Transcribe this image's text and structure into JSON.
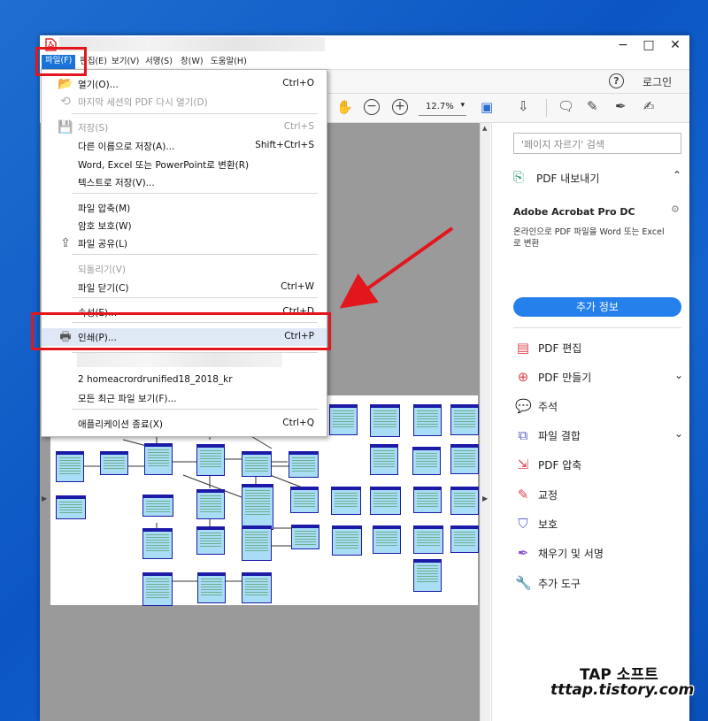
{
  "menubar": {
    "items": [
      "파일(F)",
      "편집(E)",
      "보기(V)",
      "서명(S)",
      "창(W)",
      "도움말(H)"
    ]
  },
  "window_controls": {
    "minimize": "−",
    "maximize": "□",
    "close": "✕"
  },
  "toolbar": {
    "help": "?",
    "login": "로그인",
    "zoom": "12.7%"
  },
  "file_menu": {
    "items": [
      {
        "label": "열기(O)...",
        "shortcut": "Ctrl+O",
        "disabled": false,
        "icon": "folder-open-icon"
      },
      {
        "label": "마지막 세션의 PDF 다시 열기(D)",
        "shortcut": "",
        "disabled": true,
        "icon": "reopen-icon"
      },
      {
        "label": "저장(S)",
        "shortcut": "Ctrl+S",
        "disabled": true,
        "icon": "save-icon"
      },
      {
        "label": "다른 이름으로 저장(A)...",
        "shortcut": "Shift+Ctrl+S",
        "disabled": false,
        "icon": ""
      },
      {
        "label": "Word, Excel 또는 PowerPoint로 변환(R)",
        "shortcut": "",
        "disabled": false,
        "icon": ""
      },
      {
        "label": "텍스트로 저장(V)...",
        "shortcut": "",
        "disabled": false,
        "icon": ""
      },
      {
        "label": "파일 압축(M)",
        "shortcut": "",
        "disabled": false,
        "icon": ""
      },
      {
        "label": "암호 보호(W)",
        "shortcut": "",
        "disabled": false,
        "icon": ""
      },
      {
        "label": "파일 공유(L)",
        "shortcut": "",
        "disabled": false,
        "icon": "share-icon"
      },
      {
        "label": "되돌리기(V)",
        "shortcut": "",
        "disabled": true,
        "icon": ""
      },
      {
        "label": "파일 닫기(C)",
        "shortcut": "Ctrl+W",
        "disabled": false,
        "icon": ""
      },
      {
        "label": "속성(E)...",
        "shortcut": "Ctrl+D",
        "disabled": false,
        "icon": ""
      },
      {
        "label": "인쇄(P)...",
        "shortcut": "Ctrl+P",
        "disabled": false,
        "icon": "printer-icon"
      },
      {
        "label": "2 homeacrordrunified18_2018_kr",
        "shortcut": "",
        "disabled": false,
        "icon": ""
      },
      {
        "label": "모든 최근 파일 보기(F)...",
        "shortcut": "",
        "disabled": false,
        "icon": ""
      },
      {
        "label": "애플리케이션 종료(X)",
        "shortcut": "Ctrl+Q",
        "disabled": false,
        "icon": ""
      }
    ]
  },
  "right_panel": {
    "search_placeholder": "'페이지 자르기' 검색",
    "export_title": "PDF 내보내기",
    "product_name": "Adobe Acrobat Pro DC",
    "product_desc_1": "온라인으로 PDF 파일을 Word 또는 Excel",
    "product_desc_2": "로 변환",
    "more_info_button": "추가 정보",
    "tools": [
      {
        "label": "PDF 편집",
        "icon": "pdf-edit-icon",
        "color": "#e0454f",
        "chevron": false
      },
      {
        "label": "PDF 만들기",
        "icon": "pdf-create-icon",
        "color": "#e0454f",
        "chevron": true
      },
      {
        "label": "주석",
        "icon": "comment-icon",
        "color": "#f2b632",
        "chevron": false
      },
      {
        "label": "파일 결합",
        "icon": "combine-icon",
        "color": "#5b5fc7",
        "chevron": true
      },
      {
        "label": "PDF 압축",
        "icon": "compress-icon",
        "color": "#e0454f",
        "chevron": false
      },
      {
        "label": "교정",
        "icon": "redact-icon",
        "color": "#e0454f",
        "chevron": false
      },
      {
        "label": "보호",
        "icon": "protect-icon",
        "color": "#5b5fc7",
        "chevron": false
      },
      {
        "label": "채우기 및 서명",
        "icon": "fill-sign-icon",
        "color": "#8a54c8",
        "chevron": false
      },
      {
        "label": "추가 도구",
        "icon": "more-tools-icon",
        "color": "#555555",
        "chevron": false
      }
    ]
  },
  "watermark": {
    "line1": "TAP 소프트",
    "line2": "tttap.tistory.com"
  },
  "colors": {
    "highlight_red": "#e3161d",
    "menu_active": "#1a73d9",
    "more_info_blue": "#2680eb"
  }
}
